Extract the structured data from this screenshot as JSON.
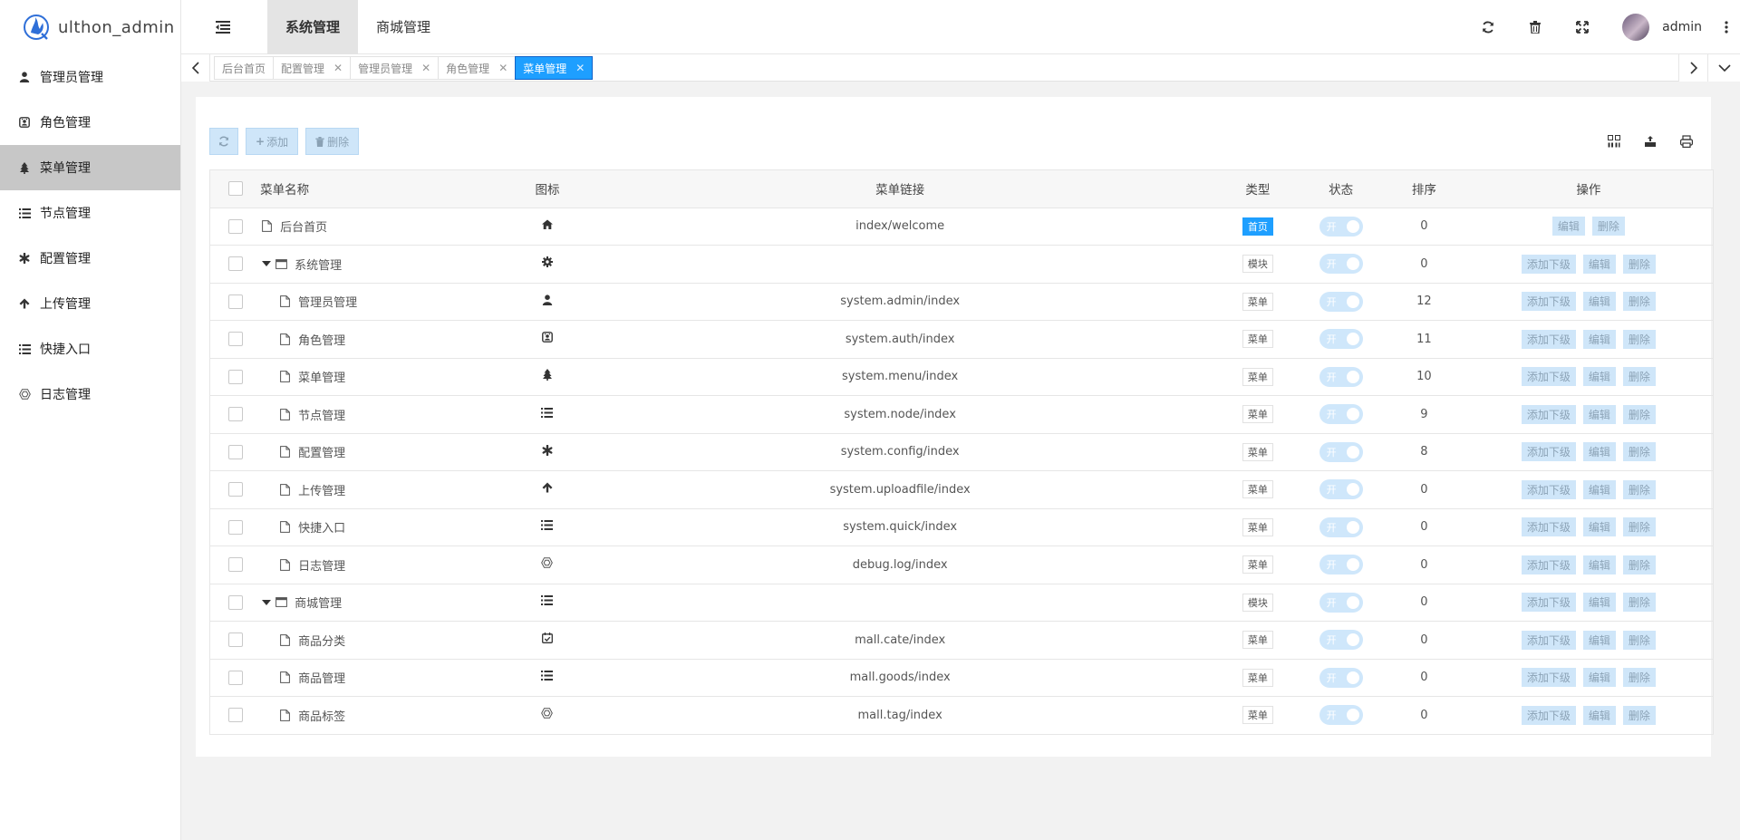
{
  "app": {
    "title": "ulthon_admin"
  },
  "topnav": [
    {
      "label": "系统管理",
      "active": true
    },
    {
      "label": "商城管理",
      "active": false
    }
  ],
  "header_icons": [
    "refresh-icon",
    "trash-icon",
    "fullscreen-icon"
  ],
  "user": {
    "name": "admin"
  },
  "sidebar": {
    "items": [
      {
        "label": "管理员管理",
        "icon": "user-icon"
      },
      {
        "label": "角色管理",
        "icon": "role-icon"
      },
      {
        "label": "菜单管理",
        "icon": "tree-icon",
        "active": true
      },
      {
        "label": "节点管理",
        "icon": "list-icon"
      },
      {
        "label": "配置管理",
        "icon": "asterisk-icon"
      },
      {
        "label": "上传管理",
        "icon": "arrow-up-icon"
      },
      {
        "label": "快捷入口",
        "icon": "list-icon"
      },
      {
        "label": "日志管理",
        "icon": "hexagon-icon"
      }
    ]
  },
  "tabs": [
    {
      "label": "后台首页",
      "closable": false
    },
    {
      "label": "配置管理",
      "closable": true
    },
    {
      "label": "管理员管理",
      "closable": true
    },
    {
      "label": "角色管理",
      "closable": true
    },
    {
      "label": "菜单管理",
      "closable": true,
      "active": true
    }
  ],
  "toolbar": {
    "add_label": "添加",
    "delete_label": "删除"
  },
  "table": {
    "headers": {
      "name": "菜单名称",
      "icon": "图标",
      "href": "菜单链接",
      "type": "类型",
      "status": "状态",
      "sort": "排序",
      "ops": "操作"
    },
    "switch_on_label": "开",
    "actions": {
      "add_child": "添加下级",
      "edit": "编辑",
      "delete": "删除"
    },
    "rows": [
      {
        "name": "后台首页",
        "level": 0,
        "kind": "file",
        "icon": "home-icon",
        "href": "index/welcome",
        "type": "首页",
        "type_home": true,
        "sort": "0"
      },
      {
        "name": "系统管理",
        "level": 0,
        "kind": "folder",
        "icon": "gear-icon",
        "href": "",
        "type": "模块",
        "sort": "0"
      },
      {
        "name": "管理员管理",
        "level": 1,
        "kind": "file",
        "icon": "user-icon",
        "href": "system.admin/index",
        "type": "菜单",
        "sort": "12"
      },
      {
        "name": "角色管理",
        "level": 1,
        "kind": "file",
        "icon": "role-icon",
        "href": "system.auth/index",
        "type": "菜单",
        "sort": "11"
      },
      {
        "name": "菜单管理",
        "level": 1,
        "kind": "file",
        "icon": "tree-icon",
        "href": "system.menu/index",
        "type": "菜单",
        "sort": "10"
      },
      {
        "name": "节点管理",
        "level": 1,
        "kind": "file",
        "icon": "list-icon",
        "href": "system.node/index",
        "type": "菜单",
        "sort": "9"
      },
      {
        "name": "配置管理",
        "level": 1,
        "kind": "file",
        "icon": "asterisk-icon",
        "href": "system.config/index",
        "type": "菜单",
        "sort": "8"
      },
      {
        "name": "上传管理",
        "level": 1,
        "kind": "file",
        "icon": "arrow-up-icon",
        "href": "system.uploadfile/index",
        "type": "菜单",
        "sort": "0"
      },
      {
        "name": "快捷入口",
        "level": 1,
        "kind": "file",
        "icon": "list-icon",
        "href": "system.quick/index",
        "type": "菜单",
        "sort": "0"
      },
      {
        "name": "日志管理",
        "level": 1,
        "kind": "file",
        "icon": "hexagon-icon",
        "href": "debug.log/index",
        "type": "菜单",
        "sort": "0"
      },
      {
        "name": "商城管理",
        "level": 0,
        "kind": "folder",
        "icon": "list-icon",
        "href": "",
        "type": "模块",
        "sort": "0"
      },
      {
        "name": "商品分类",
        "level": 1,
        "kind": "file",
        "icon": "calendar-check-icon",
        "href": "mall.cate/index",
        "type": "菜单",
        "sort": "0"
      },
      {
        "name": "商品管理",
        "level": 1,
        "kind": "file",
        "icon": "list-icon",
        "href": "mall.goods/index",
        "type": "菜单",
        "sort": "0"
      },
      {
        "name": "商品标签",
        "level": 1,
        "kind": "file",
        "icon": "hexagon-icon",
        "href": "mall.tag/index",
        "type": "菜单",
        "sort": "0"
      }
    ]
  }
}
